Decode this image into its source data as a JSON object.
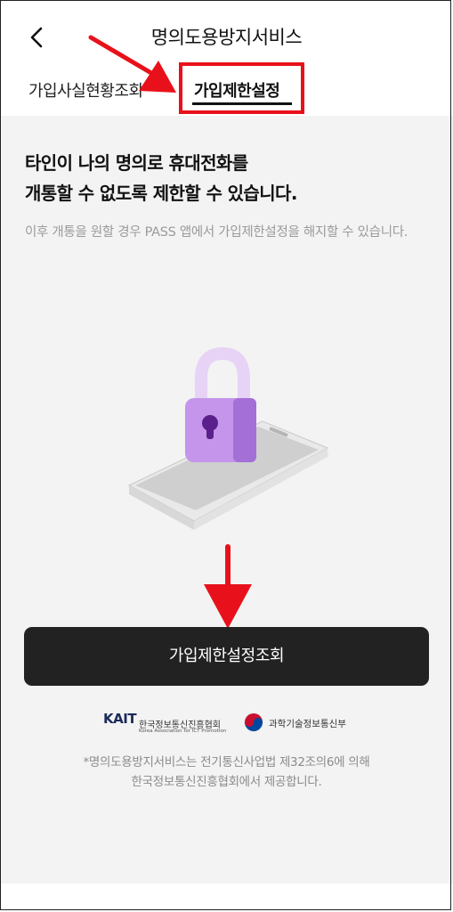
{
  "header": {
    "title": "명의도용방지서비스",
    "back_icon": "chevron-left-icon"
  },
  "tabs": [
    {
      "label": "가입사실현황조회"
    },
    {
      "label": "가입제한설정"
    }
  ],
  "main": {
    "headline_line1": "타인이 나의 명의로 휴대전화를",
    "headline_line2": "개통할 수 없도록 제한할 수 있습니다.",
    "subtext": "이후 개통을 원할 경우 PASS 앱에서 가입제한설정을 해지할 수 있습니다.",
    "illustration": "phone-with-padlock"
  },
  "cta": {
    "label": "가입제한설정조회"
  },
  "partners": {
    "kait_mark": "KAIT",
    "kait_korean": "한국정보통신진흥협회",
    "kait_english": "Korea Association for ICT Promotion",
    "msit_korean": "과학기술정보통신부"
  },
  "footer": {
    "line1": "*명의도용방지서비스는 전기통신사업법 제32조의6에 의해",
    "line2": "한국정보통신진흥협회에서 제공합니다."
  },
  "annotation_color": "#e8111b"
}
